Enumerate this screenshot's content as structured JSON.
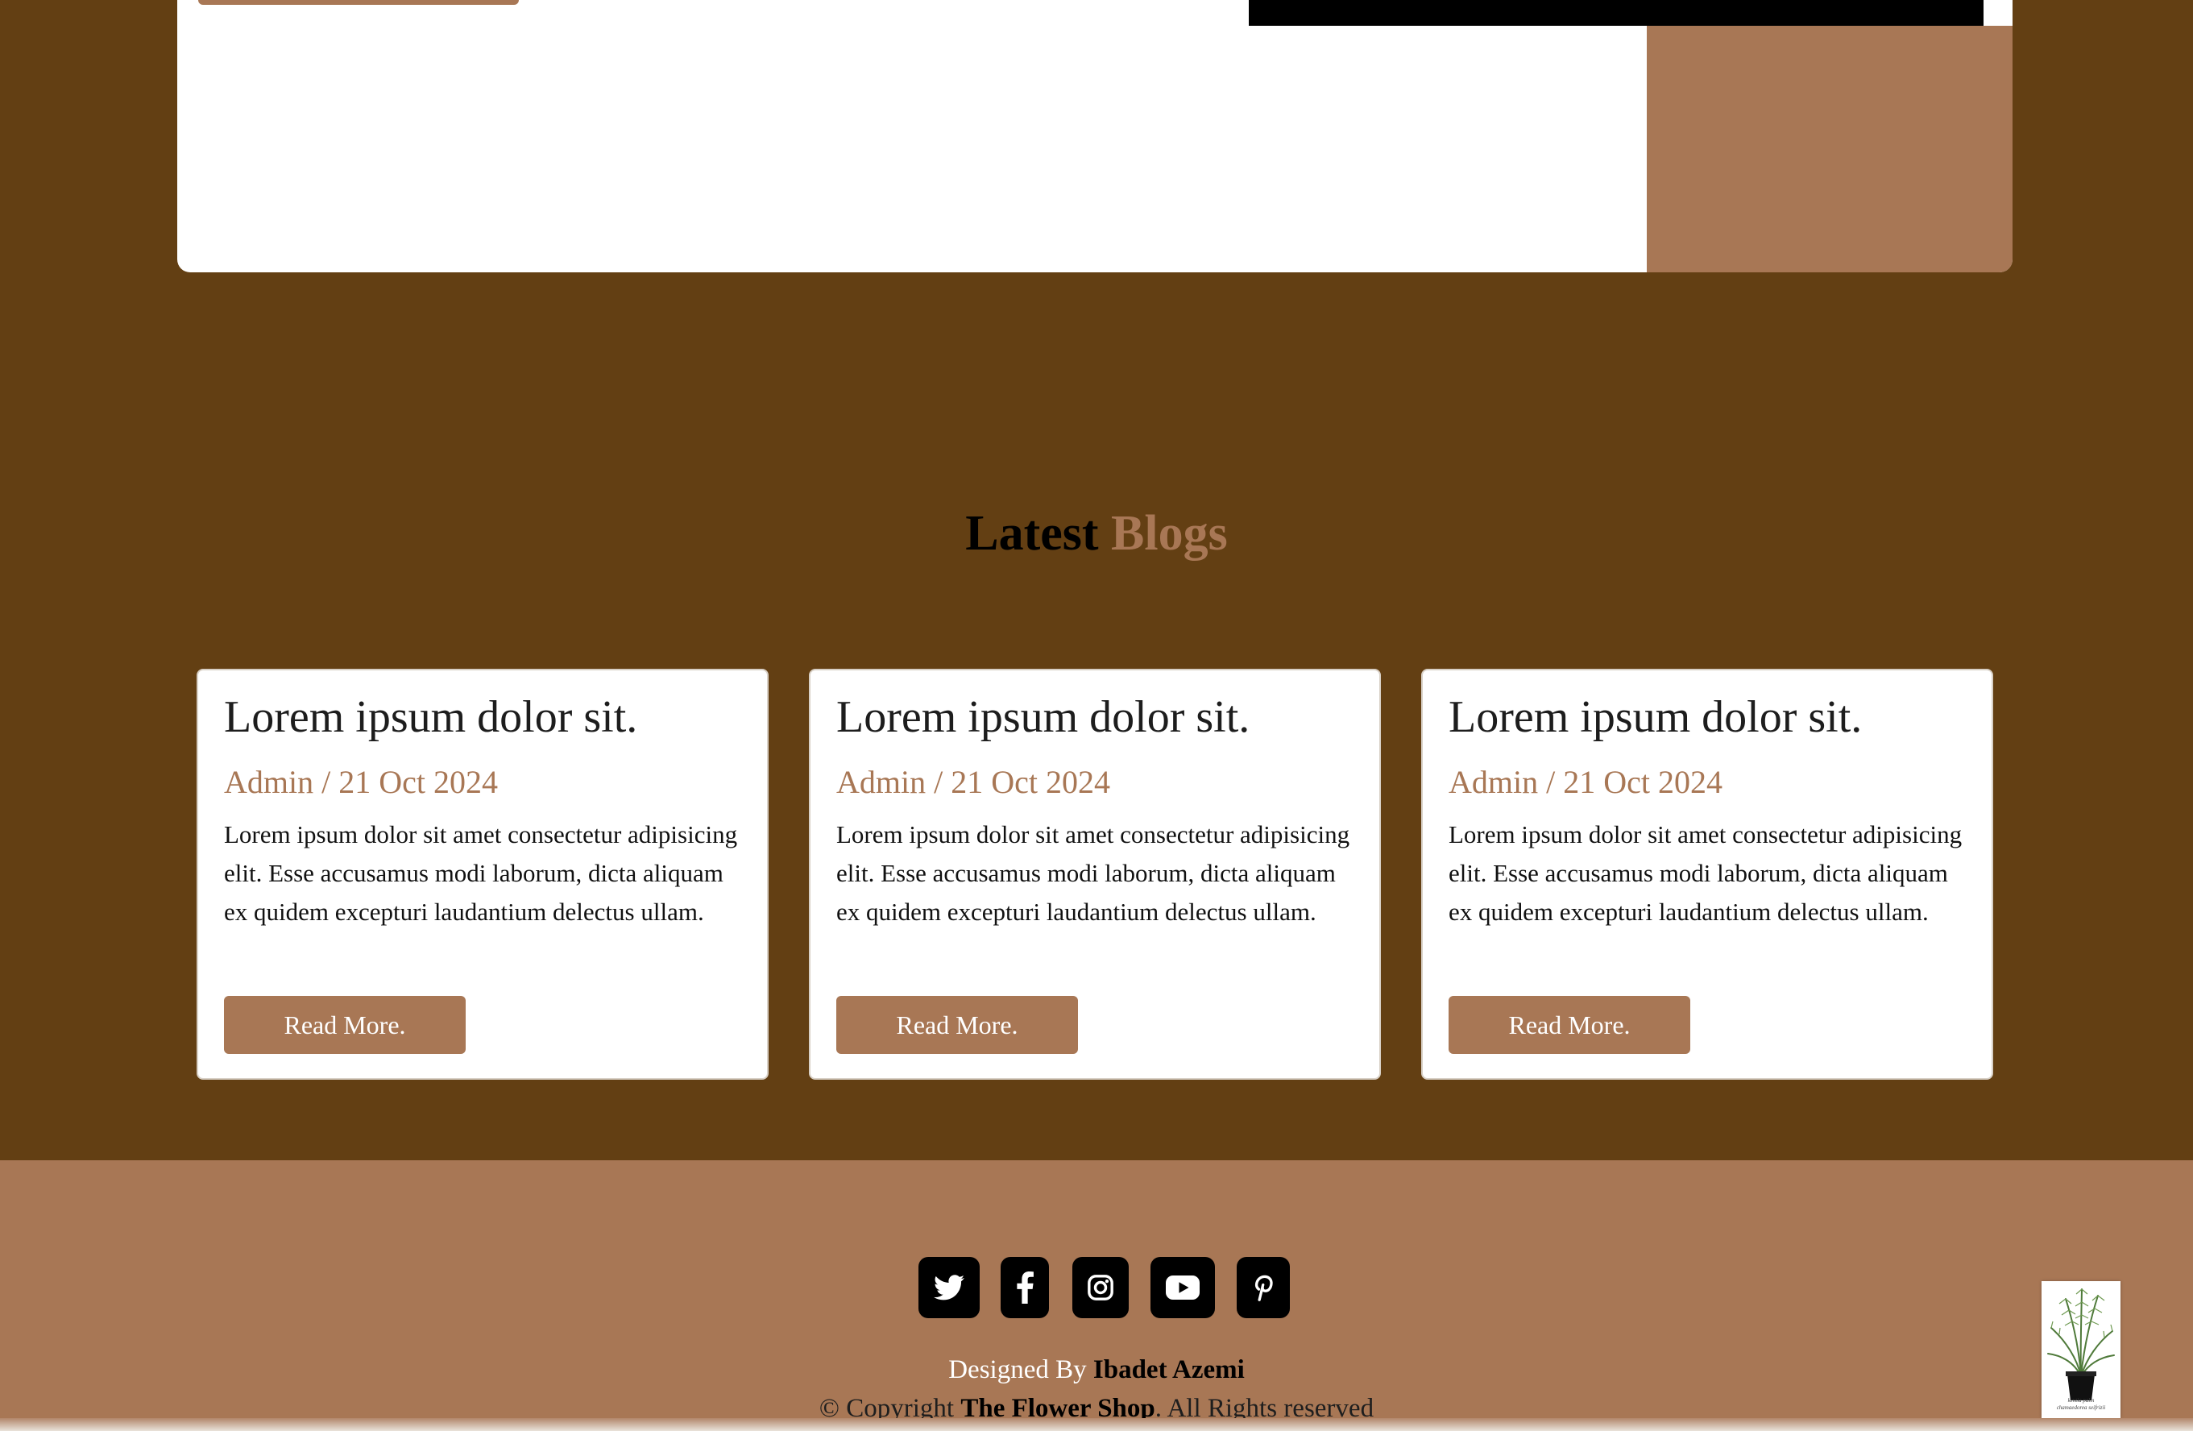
{
  "colors": {
    "page_bg": "#633f13",
    "accent": "#a87755",
    "card_bg": "#ffffff",
    "black": "#000000"
  },
  "blogs": {
    "title_part1": "Latest",
    "title_part2": "Blogs",
    "posts": [
      {
        "title": "Lorem ipsum dolor sit.",
        "meta": "Admin / 21 Oct 2024",
        "excerpt": "Lorem ipsum dolor sit amet consectetur adipisicing elit. Esse accusamus modi laborum, dicta aliquam ex quidem excepturi laudantium delectus ullam.",
        "button": "Read More."
      },
      {
        "title": "Lorem ipsum dolor sit.",
        "meta": "Admin / 21 Oct 2024",
        "excerpt": "Lorem ipsum dolor sit amet consectetur adipisicing elit. Esse accusamus modi laborum, dicta aliquam ex quidem excepturi laudantium delectus ullam.",
        "button": "Read More."
      },
      {
        "title": "Lorem ipsum dolor sit.",
        "meta": "Admin / 21 Oct 2024",
        "excerpt": "Lorem ipsum dolor sit amet consectetur adipisicing elit. Esse accusamus modi laborum, dicta aliquam ex quidem excepturi laudantium delectus ullam.",
        "button": "Read More."
      }
    ]
  },
  "footer": {
    "social_icons": [
      "twitter-icon",
      "facebook-icon",
      "instagram-icon",
      "youtube-icon",
      "pinterest-icon"
    ],
    "designed_by_label": "Designed By",
    "designer": "Ibadet Azemi",
    "copyright_prefix": "© Copyright",
    "brand": "The Flower Shop",
    "copyright_suffix": ". All Rights reserved",
    "badge_caption_1": "kentia palm",
    "badge_caption_2": "chamaedorea seifrizii"
  }
}
